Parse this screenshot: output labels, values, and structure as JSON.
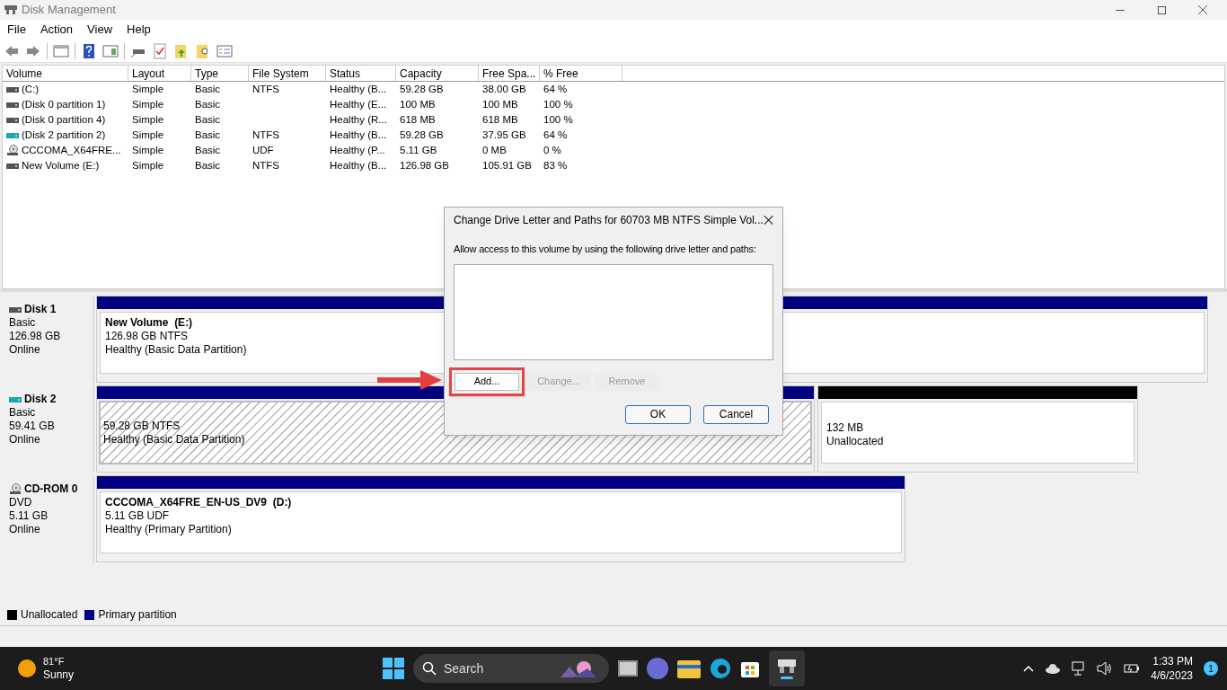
{
  "window": {
    "title": "Disk Management"
  },
  "menu": [
    "File",
    "Action",
    "View",
    "Help"
  ],
  "table": {
    "columns": [
      "Volume",
      "Layout",
      "Type",
      "File System",
      "Status",
      "Capacity",
      "Free Spa...",
      "% Free"
    ],
    "rows": [
      {
        "kind": "disk",
        "cells": [
          "(C:)",
          "Simple",
          "Basic",
          "NTFS",
          "Healthy (B...",
          "59.28 GB",
          "38.00 GB",
          "64 %"
        ]
      },
      {
        "kind": "disk",
        "cells": [
          "(Disk 0 partition 1)",
          "Simple",
          "Basic",
          "",
          "Healthy (E...",
          "100 MB",
          "100 MB",
          "100 %"
        ]
      },
      {
        "kind": "disk",
        "cells": [
          "(Disk 0 partition 4)",
          "Simple",
          "Basic",
          "",
          "Healthy (R...",
          "618 MB",
          "618 MB",
          "100 %"
        ]
      },
      {
        "kind": "usb",
        "cells": [
          "(Disk 2 partition 2)",
          "Simple",
          "Basic",
          "NTFS",
          "Healthy (B...",
          "59.28 GB",
          "37.95 GB",
          "64 %"
        ]
      },
      {
        "kind": "cd",
        "cells": [
          "CCCOMA_X64FRE...",
          "Simple",
          "Basic",
          "UDF",
          "Healthy (P...",
          "5.11 GB",
          "0 MB",
          "0 %"
        ]
      },
      {
        "kind": "disk",
        "cells": [
          "New Volume (E:)",
          "Simple",
          "Basic",
          "NTFS",
          "Healthy (B...",
          "126.98 GB",
          "105.91 GB",
          "83 %"
        ]
      }
    ]
  },
  "disks": [
    {
      "kind": "disk",
      "name": "Disk 1",
      "lines": [
        "Basic",
        "126.98 GB",
        "Online"
      ],
      "partitions": [
        {
          "kind": "primary",
          "selected": false,
          "title": "New Volume  (E:)",
          "lines": [
            "126.98 GB NTFS",
            "Healthy (Basic Data Partition)"
          ]
        }
      ]
    },
    {
      "kind": "usb",
      "name": "Disk 2",
      "lines": [
        "Basic",
        "59.41 GB",
        "Online"
      ],
      "partitions": [
        {
          "kind": "primary",
          "selected": true,
          "lines": [
            "59.28 GB NTFS",
            "Healthy (Basic Data Partition)"
          ]
        },
        {
          "kind": "unallocated",
          "selected": false,
          "lines": [
            "132 MB",
            "Unallocated"
          ]
        }
      ]
    },
    {
      "kind": "cd",
      "name": "CD-ROM 0",
      "lines": [
        "DVD",
        "5.11 GB",
        "Online"
      ],
      "partitions": [
        {
          "kind": "primary",
          "selected": false,
          "title": "CCCOMA_X64FRE_EN-US_DV9  (D:)",
          "lines": [
            "5.11 GB UDF",
            "Healthy (Primary Partition)"
          ]
        }
      ]
    }
  ],
  "legend": [
    {
      "label": "Unallocated",
      "color": "#000000"
    },
    {
      "label": "Primary partition",
      "color": "#000080"
    }
  ],
  "dialog": {
    "title": "Change Drive Letter and Paths for 60703 MB NTFS Simple Vol...",
    "prompt": "Allow access to this volume by using the following drive letter and paths:",
    "buttons": [
      {
        "label": "Add...",
        "disabled": false,
        "highlighted": true
      },
      {
        "label": "Change...",
        "disabled": true,
        "highlighted": false
      },
      {
        "label": "Remove",
        "disabled": true,
        "highlighted": false
      }
    ],
    "ok": "OK",
    "cancel": "Cancel"
  },
  "taskbar": {
    "temperature": "81°F",
    "weather": "Sunny",
    "search": {
      "placeholder": "Search"
    },
    "time": "1:33 PM",
    "date": "4/6/2023",
    "notifications": "1"
  }
}
